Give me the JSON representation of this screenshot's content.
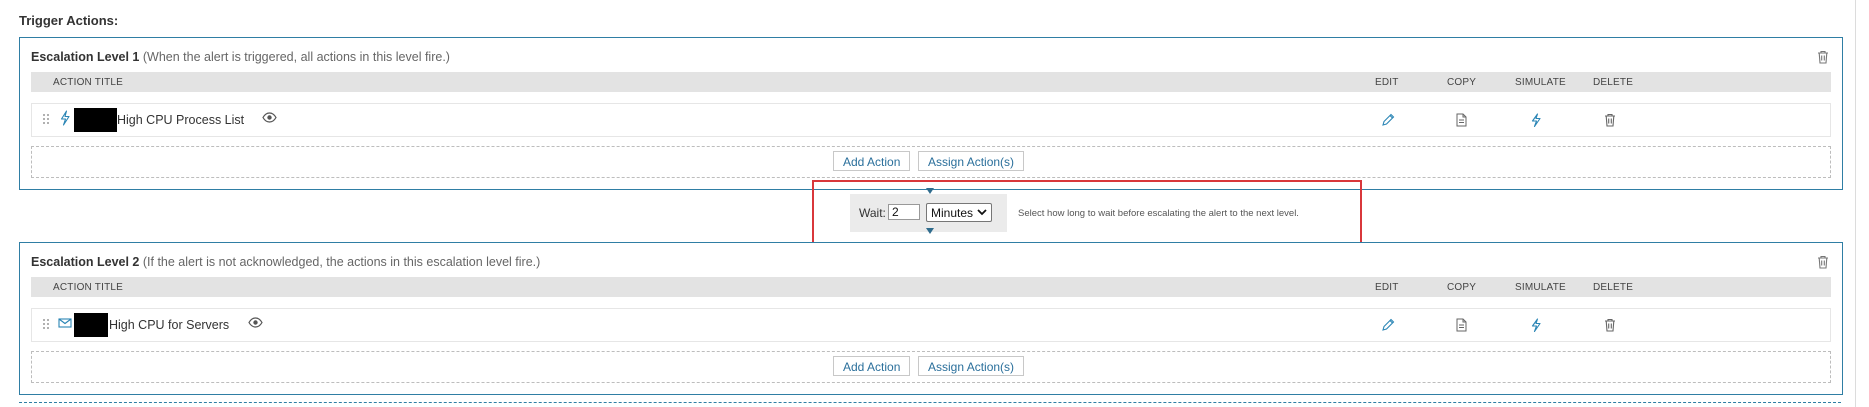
{
  "section_title": "Trigger Actions:",
  "columns": {
    "action_title": "ACTION TITLE",
    "edit": "EDIT",
    "copy": "COPY",
    "simulate": "SIMULATE",
    "delete": "DELETE"
  },
  "levels": [
    {
      "name": "Escalation Level 1",
      "description": "(When the alert is triggered, all actions in this level fire.)",
      "action": {
        "type_icon": "lightning-icon",
        "title": "High CPU Process List"
      },
      "add_action": "Add Action",
      "assign_actions": "Assign Action(s)"
    },
    {
      "name": "Escalation Level 2",
      "description": "(If the alert is not acknowledged, the actions in this escalation level fire.)",
      "action": {
        "type_icon": "email-icon",
        "title": "High CPU for Servers"
      },
      "add_action": "Add Action",
      "assign_actions": "Assign Action(s)"
    }
  ],
  "wait": {
    "label": "Wait:",
    "value": "2",
    "unit": "Minutes",
    "hint": "Select how long to wait before escalating the alert to the next level."
  },
  "colors": {
    "accent": "#2f7ea4",
    "link": "#2a6f9b",
    "highlight": "#d9373b",
    "grid_header_bg": "#e3e3e3"
  }
}
